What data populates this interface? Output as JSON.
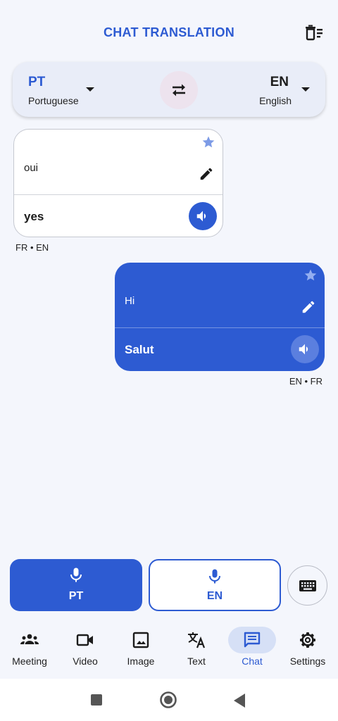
{
  "header": {
    "title": "CHAT TRANSLATION",
    "clear_icon": "clear-history-icon"
  },
  "language_bar": {
    "source": {
      "code": "PT",
      "name": "Portuguese"
    },
    "target": {
      "code": "EN",
      "name": "English"
    },
    "swap_icon": "swap-arrows-icon"
  },
  "messages": [
    {
      "side": "left",
      "source_text": "oui",
      "translation": "yes",
      "pair": "FR • EN",
      "starred": false
    },
    {
      "side": "right",
      "source_text": "Hi",
      "translation": "Salut",
      "pair": "EN • FR",
      "starred": false
    }
  ],
  "mic_buttons": {
    "source_label": "PT",
    "target_label": "EN"
  },
  "bottom_nav": {
    "items": [
      {
        "label": "Meeting",
        "icon": "groups-icon"
      },
      {
        "label": "Video",
        "icon": "videocam-icon"
      },
      {
        "label": "Image",
        "icon": "image-icon"
      },
      {
        "label": "Text",
        "icon": "translate-icon"
      },
      {
        "label": "Chat",
        "icon": "chat-icon"
      },
      {
        "label": "Settings",
        "icon": "settings-icon"
      }
    ],
    "active": "Chat"
  },
  "colors": {
    "accent": "#2d5bd2",
    "background": "#f4f6fc",
    "nav_active_pill": "#d6e0f6"
  }
}
